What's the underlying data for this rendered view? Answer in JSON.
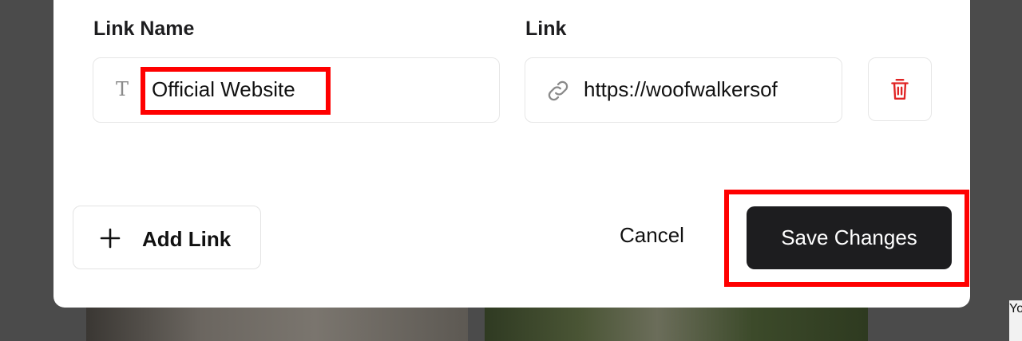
{
  "form": {
    "name_label": "Link Name",
    "link_label": "Link",
    "name_value": "Official Website",
    "link_value": "https://woofwalkersof",
    "name_icon": "T",
    "link_icon": "link-icon",
    "delete_icon": "trash-icon"
  },
  "actions": {
    "add_link_label": "Add Link",
    "add_icon": "plus-icon",
    "cancel_label": "Cancel",
    "save_label": "Save Changes"
  },
  "background": {
    "side_text": "Yo"
  },
  "colors": {
    "primary_button": "#1d1d1f",
    "delete_icon": "#e02424",
    "highlight": "#ff0000"
  }
}
